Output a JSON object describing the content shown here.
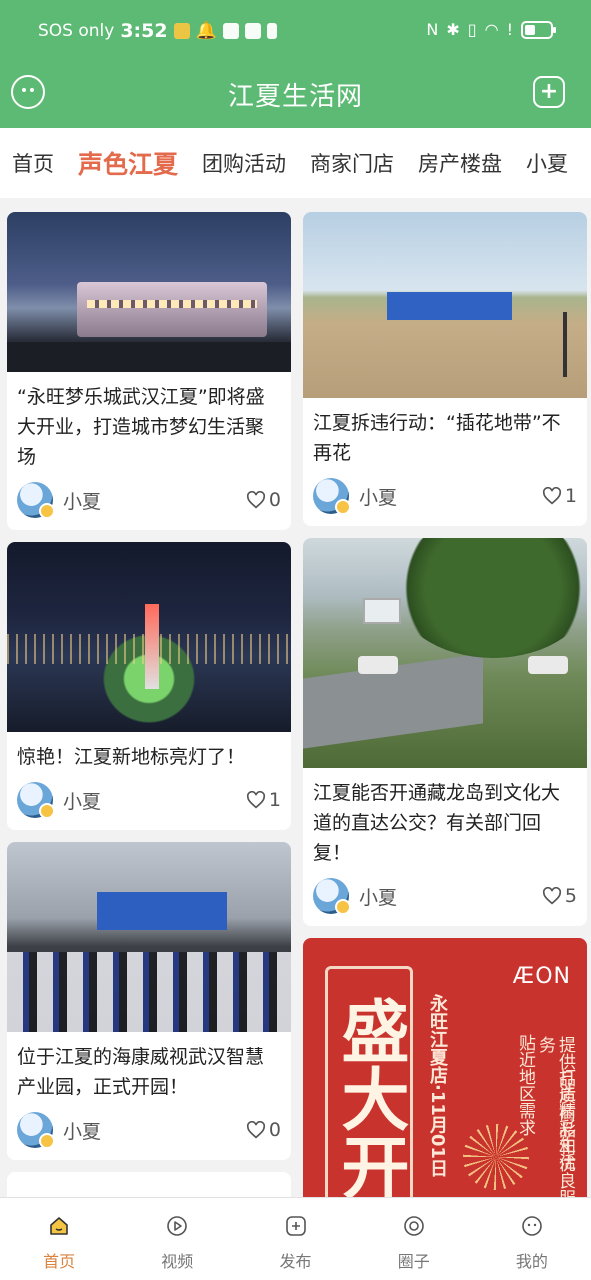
{
  "status_bar": {
    "carrier": "SOS only",
    "time": "3:52"
  },
  "app_bar": {
    "title": "江夏生活网"
  },
  "tabs": [
    {
      "label": "首页",
      "active": false
    },
    {
      "label": "声色江夏",
      "active": true
    },
    {
      "label": "团购活动",
      "active": false
    },
    {
      "label": "商家门店",
      "active": false
    },
    {
      "label": "房产楼盘",
      "active": false
    },
    {
      "label": "小夏",
      "active": false
    }
  ],
  "feed": {
    "left": [
      {
        "title": "“永旺梦乐城武汉江夏”即将盛大开业，打造城市梦幻生活聚场",
        "author": "小夏",
        "likes": "0"
      },
      {
        "title": "惊艳！江夏新地标亮灯了！",
        "author": "小夏",
        "likes": "1"
      },
      {
        "title": "位于江夏的海康威视武汉智慧产业园，正式开园！",
        "author": "小夏",
        "likes": "0"
      }
    ],
    "right": [
      {
        "title": "江夏拆违行动：“插花地带”不再花",
        "author": "小夏",
        "likes": "1"
      },
      {
        "title": "江夏能否开通藏龙岛到文化大道的直达公交？有关部门回复！",
        "author": "小夏",
        "likes": "5"
      },
      {
        "image_text": {
          "big": "盛大开",
          "logo": "ÆON",
          "store": "永旺江夏店·11月01日",
          "line1": "贴近地区需求",
          "line2": "提供品质商品和优良服务",
          "line3": "打造精彩生活"
        }
      }
    ]
  },
  "bottom_nav": [
    {
      "label": "首页",
      "active": true,
      "icon": "home-icon"
    },
    {
      "label": "视频",
      "active": false,
      "icon": "video-icon"
    },
    {
      "label": "发布",
      "active": false,
      "icon": "publish-icon"
    },
    {
      "label": "圈子",
      "active": false,
      "icon": "circle-icon"
    },
    {
      "label": "我的",
      "active": false,
      "icon": "profile-icon"
    }
  ],
  "colors": {
    "brand_green": "#5dba74",
    "active_tab": "#e46a4c",
    "nav_active": "#d9833f"
  }
}
